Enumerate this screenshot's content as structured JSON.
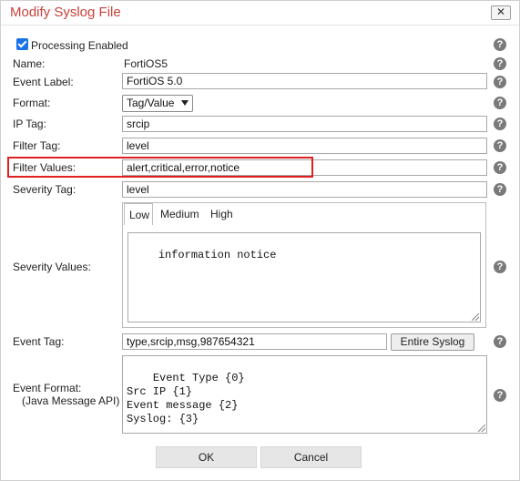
{
  "dialog": {
    "title": "Modify Syslog File",
    "close_label": "✕"
  },
  "form": {
    "processing_enabled": {
      "label": "Processing Enabled",
      "checked": true
    },
    "name": {
      "label": "Name:",
      "value": "FortiOS5"
    },
    "event_label": {
      "label": "Event Label:",
      "value": "FortiOS 5.0"
    },
    "format": {
      "label": "Format:",
      "value": "Tag/Value"
    },
    "ip_tag": {
      "label": "IP Tag:",
      "value": "srcip"
    },
    "filter_tag": {
      "label": "Filter Tag:",
      "value": "level"
    },
    "filter_values": {
      "label": "Filter Values:",
      "value": "alert,critical,error,notice"
    },
    "severity_tag": {
      "label": "Severity Tag:",
      "value": "level"
    },
    "severity_values": {
      "label": "Severity Values:",
      "tabs": [
        "Low",
        "Medium",
        "High"
      ],
      "active_tab": "Low",
      "value": "information notice"
    },
    "event_tag": {
      "label": "Event Tag:",
      "value": "type,srcip,msg,987654321",
      "button": "Entire Syslog"
    },
    "event_format": {
      "label": "Event Format:",
      "sublabel": "(Java Message API)",
      "value": "Event Type {0}\nSrc IP {1}\nEvent message {2}\nSyslog: {3}"
    }
  },
  "help_icon": "?",
  "buttons": {
    "ok": "OK",
    "cancel": "Cancel"
  },
  "colors": {
    "title": "#c9413a",
    "highlight": "#e02020",
    "checkbox": "#1a73e8"
  }
}
